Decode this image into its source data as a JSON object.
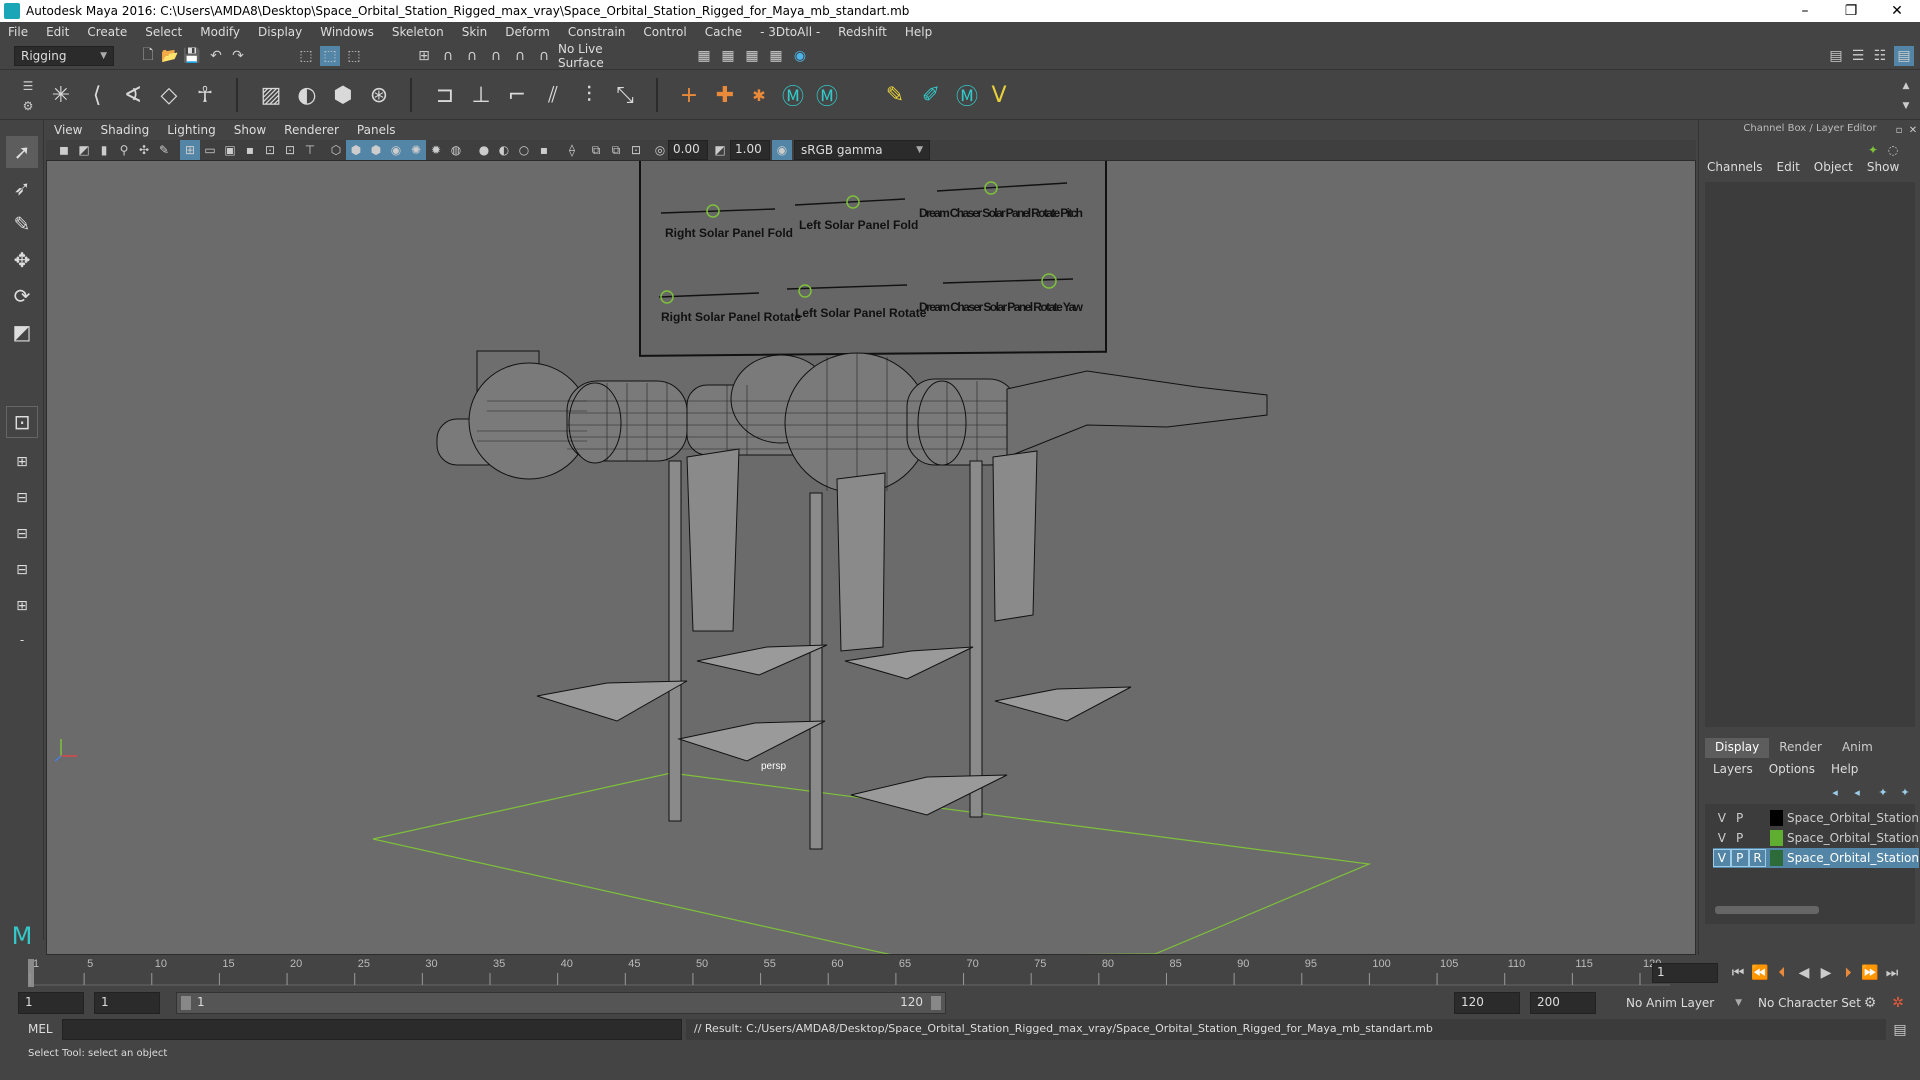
{
  "title": "Autodesk Maya 2016: C:\\Users\\AMDA8\\Desktop\\Space_Orbital_Station_Rigged_max_vray\\Space_Orbital_Station_Rigged_for_Maya_mb_standart.mb",
  "window_buttons": [
    "–",
    "❐",
    "✕"
  ],
  "menus": [
    "File",
    "Edit",
    "Create",
    "Select",
    "Modify",
    "Display",
    "Windows",
    "Skeleton",
    "Skin",
    "Deform",
    "Constrain",
    "Control",
    "Cache",
    "- 3DtoAll -",
    "Redshift",
    "Help"
  ],
  "status": {
    "mode": "Rigging",
    "live_surface": "No Live Surface"
  },
  "viewport": {
    "menus": [
      "View",
      "Shading",
      "Lighting",
      "Show",
      "Renderer",
      "Panels"
    ],
    "exposure": "0.00",
    "gamma": "1.00",
    "colorspace": "sRGB gamma",
    "camera_label": "persp",
    "controls": [
      "Right Solar Panel Fold",
      "Left Solar Panel Fold",
      "Dream Chaser Solar Panel Rotate Pitch",
      "Right Solar Panel Rotate",
      "Left Solar Panel Rotate",
      "Dream Chaser Solar Panel Rotate Yaw"
    ]
  },
  "channel_box": {
    "title": "Channel Box / Layer Editor",
    "menus": [
      "Channels",
      "Edit",
      "Object",
      "Show"
    ]
  },
  "layer_editor": {
    "tabs": [
      "Display",
      "Render",
      "Anim"
    ],
    "menus": [
      "Layers",
      "Options",
      "Help"
    ],
    "layers": [
      {
        "v": "V",
        "p": "P",
        "r": "",
        "name": "Space_Orbital_Station",
        "color": "#000000",
        "selected": false
      },
      {
        "v": "V",
        "p": "P",
        "r": "",
        "name": "Space_Orbital_Station",
        "color": "#5fae32",
        "selected": false
      },
      {
        "v": "V",
        "p": "P",
        "r": "R",
        "name": "Space_Orbital_Station",
        "color": "#2e6b3a",
        "selected": true
      }
    ]
  },
  "timeline": {
    "ticks": [
      "1",
      "5",
      "10",
      "15",
      "20",
      "25",
      "30",
      "35",
      "40",
      "45",
      "50",
      "55",
      "60",
      "65",
      "70",
      "75",
      "80",
      "85",
      "90",
      "95",
      "100",
      "105",
      "110",
      "115",
      "120"
    ],
    "current_frame": "1"
  },
  "range": {
    "start": "1",
    "playback_start": "1",
    "slider_start": "1",
    "slider_end": "120",
    "playback_end": "120",
    "end": "200",
    "anim_layer": "No Anim Layer",
    "char_set": "No Character Set"
  },
  "command": {
    "lang": "MEL",
    "result": "// Result: C:/Users/AMDA8/Desktop/Space_Orbital_Station_Rigged_max_vray/Space_Orbital_Station_Rigged_for_Maya_mb_standart.mb"
  },
  "help_text": "Select Tool: select an object",
  "colors": {
    "accent": "#5285a6",
    "grid_green": "#7ec13a"
  }
}
